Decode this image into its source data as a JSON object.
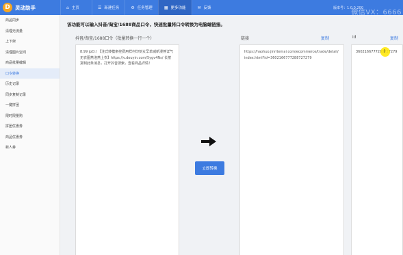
{
  "app": {
    "logo_char": "D",
    "name": "灵动助手",
    "version": "版本号：1.0.0.200",
    "watermark": "微信VX：6666"
  },
  "tabs": [
    {
      "label": "主页",
      "icon": "home-icon"
    },
    {
      "label": "新建任务",
      "icon": "list-icon"
    },
    {
      "label": "任务管理",
      "icon": "settings-icon"
    },
    {
      "label": "更多功能",
      "icon": "grid-icon"
    },
    {
      "label": "反馈",
      "icon": "mail-icon"
    }
  ],
  "sidebar": {
    "items": [
      {
        "label": "商品同步"
      },
      {
        "label": "清理无流量"
      },
      {
        "label": "上下架"
      },
      {
        "label": "清理图片空间"
      },
      {
        "label": "商品批量编辑"
      },
      {
        "label": "口令转换"
      },
      {
        "label": "历史记录"
      },
      {
        "label": "同步复制记录"
      },
      {
        "label": "一键拼团"
      },
      {
        "label": "限时限量购"
      },
      {
        "label": "拼团优惠券"
      },
      {
        "label": "商品优惠券"
      },
      {
        "label": "新人券"
      }
    ],
    "active_index": 5
  },
  "main": {
    "instruction": "该功能可以输入抖音/淘宝/1688商品口令，快速批量将口令转换为电脑端链接。",
    "input_label": "抖音/淘宝/1688口令（批量转换一行一个）",
    "input_text": "8.99 jpO:/ 【注式转模条控费用样村印刻女早单减新漫燕详气无衣图燕泡燕上衣】https://v.douyin.com/5ygv4Ns/ 长按复制此条消息，打开抖音搜索，查看商品详情！",
    "convert_button": "立即转换",
    "link_label": "链接",
    "link_copy": "复制",
    "link_text": "https://haohuo.jinritemai.com/ecommerce/trade/detail/index.html?id=3602166777288727279",
    "id_label": "id",
    "id_copy": "复制",
    "id_text": "3602166777288727279"
  },
  "colors": {
    "primary": "#3d7be0",
    "topbar": "#3d7be0",
    "active_tab": "#2f66c4",
    "logo": "#f5a623"
  }
}
